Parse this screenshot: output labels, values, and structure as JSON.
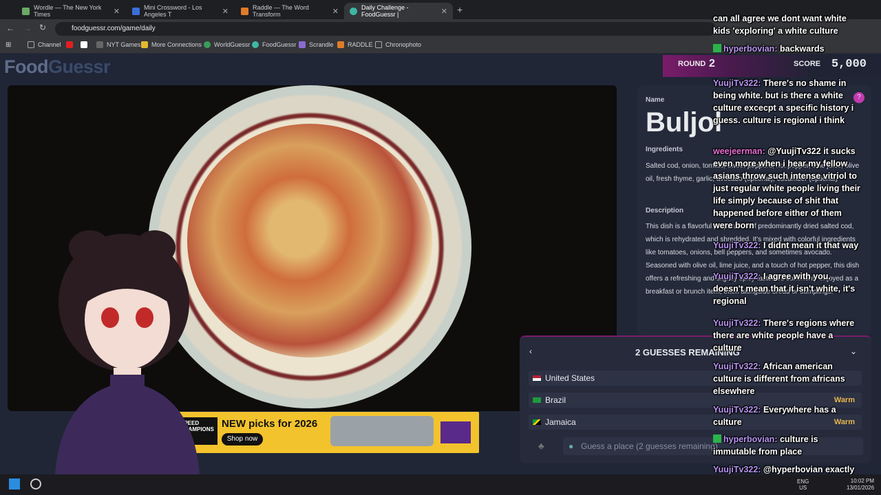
{
  "browser": {
    "tabs": [
      {
        "label": "Wordle — The New York Times",
        "color": "#6aaa64"
      },
      {
        "label": "Mini Crossword - Los Angeles T",
        "color": "#3b6fd8"
      },
      {
        "label": "Raddle — The Word Transform",
        "color": "#e07b2a"
      },
      {
        "label": "Daily Challenge - FoodGuessr |",
        "color": "#3cb8a5"
      }
    ],
    "url": "foodguessr.com/game/daily",
    "bookmarks": [
      "Channel",
      "",
      "NYT Games",
      "More Connections",
      "WorldGuessr",
      "FoodGuessr",
      "Scrandle",
      "RADDLE",
      "Chronophoto"
    ]
  },
  "game": {
    "logo_a": "Food",
    "logo_b": "Guessr",
    "round_label": "ROUND",
    "round_value": "2",
    "score_label": "SCORE",
    "score_value": "5,000",
    "dish": {
      "name_label": "Name",
      "name": "Buljol",
      "ingredients_label": "Ingredients",
      "ingredients": "Salted cod, onion, tomato, sweet peppers, hot pepper, lime juice, olive oil, fresh thyme, garlic, avocado (optional), cucumber (optional)",
      "description_label": "Description",
      "description": "This dish is a flavorful preparation of predominantly dried salted cod, which is rehydrated and shredded. It's mixed with colorful ingredients like tomatoes, onions, bell peppers, and sometimes avocado. Seasoned with olive oil, lime juice, and a touch of hot pepper, this dish offers a refreshing and slightly spicy taste. It's commonly enjoyed as a breakfast or brunch item, often alongside bread or dumplings."
    },
    "guesses_header": "2 GUESSES REMAINING",
    "guesses": [
      {
        "country": "United States",
        "result": ""
      },
      {
        "country": "Brazil",
        "result": "Warm"
      },
      {
        "country": "Jamaica",
        "result": "Warm"
      }
    ],
    "guess_placeholder": "Guess a place (2 guesses remaining)",
    "ad": {
      "headline": "NEW picks for 2026",
      "cta": "Shop now",
      "brand": "SPEED CHAMPIONS"
    }
  },
  "chat": [
    {
      "user": "",
      "text": "can all agree we dont want white kids 'exploring' a white culture"
    },
    {
      "user": "hyperbovian:",
      "text": "backwards"
    },
    {
      "user": "YuujiTv322:",
      "text": "There's no shame in being white. but is there a white culture excecpt a specific history i guess. culture is regional i think"
    },
    {
      "user": "weejeerman:",
      "text": "@YuujiTv322 it sucks even more when i hear my fellow asians throw such intense vitriol to just regular white people living their life simply because of shit that happened before either of them were born"
    },
    {
      "user": "YuujiTv322:",
      "text": "I didnt mean it that way"
    },
    {
      "user": "YuujiTv322:",
      "text": "I agree with you. doesn't mean that it isn't white, it's regional"
    },
    {
      "user": "YuujiTv322:",
      "text": "There's regions where there are white people have a culture"
    },
    {
      "user": "YuujiTv322:",
      "text": "African american culture is different from africans elsewhere"
    },
    {
      "user": "YuujiTv322:",
      "text": "Everywhere has a culture"
    },
    {
      "user": "hyperbovian:",
      "text": "culture is immutable from place"
    },
    {
      "user": "YuujiTv322:",
      "text": "@hyperbovian exactly"
    }
  ],
  "taskbar": {
    "lang": "ENG",
    "region": "US",
    "time": "10:02 PM",
    "date": "13/01/2026"
  },
  "colors": {
    "accent": "#7a1c6a",
    "warm": "#e7b64a",
    "chat_user": "#b894f2"
  }
}
